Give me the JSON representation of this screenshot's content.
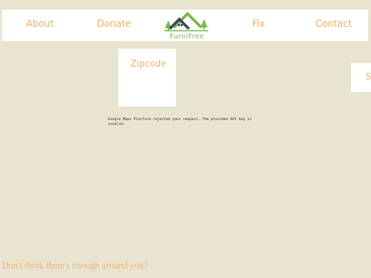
{
  "nav": {
    "links": [
      "About",
      "Donate",
      "Fix",
      "Contact"
    ],
    "logo_text": "FurniFree"
  },
  "search": {
    "zipcode_label": "Zipcode",
    "side_button_label": "S"
  },
  "map": {
    "error_message": "Google Maps Platform rejected your request. The provided API key is invalid."
  },
  "footer": {
    "prompt": "Don't think there's enough around you?"
  },
  "colors": {
    "background": "#e8e4d0",
    "accent": "#efb46e",
    "logo_green": "#7ab648",
    "logo_dark": "#3d4a5c"
  },
  "icons": [
    "house-roof-logo-icon",
    "tree-icon"
  ]
}
